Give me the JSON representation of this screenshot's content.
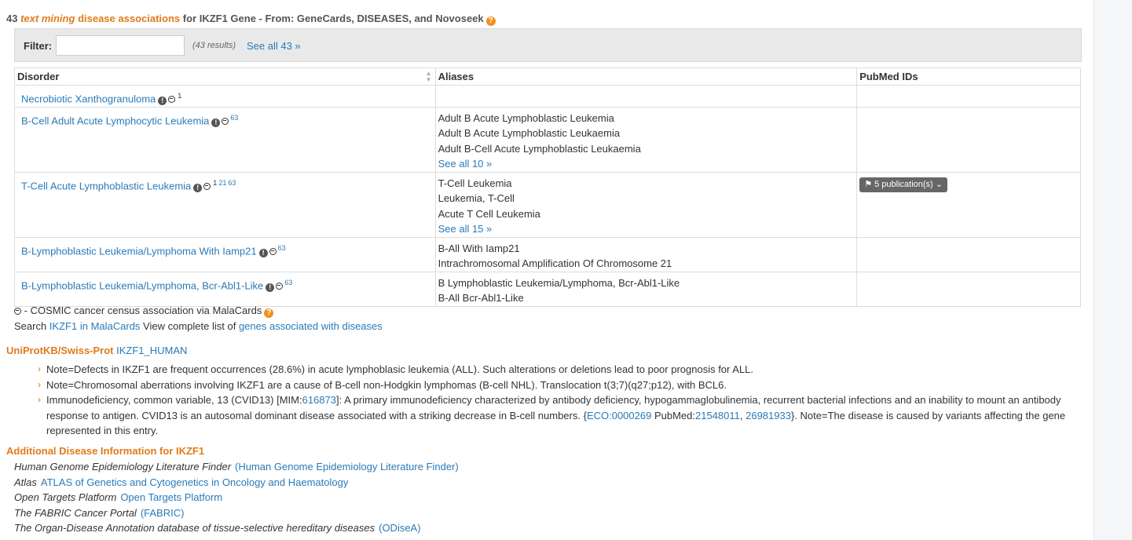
{
  "header": {
    "count": "43",
    "text_mining": "text mining",
    "disease_assoc": "disease associations",
    "rest": "for IKZF1 Gene - From: GeneCards, DISEASES, and Novoseek"
  },
  "filter": {
    "label": "Filter:",
    "value": "",
    "results": "(43 results)",
    "see_all": "See all 43 »"
  },
  "table": {
    "headers": [
      "Disorder",
      "Aliases",
      "PubMed IDs"
    ],
    "rows": [
      {
        "disorder": "Necrobiotic Xanthogranuloma",
        "sup": [
          "1"
        ],
        "aliases": [],
        "aliases_more": "",
        "pubmed": ""
      },
      {
        "disorder": "B-Cell Adult Acute Lymphocytic Leukemia",
        "sup": [
          "63"
        ],
        "aliases": [
          "Adult B Acute Lymphoblastic Leukemia",
          "Adult B Acute Lymphoblastic Leukaemia",
          "Adult B-Cell Acute Lymphoblastic Leukaemia"
        ],
        "aliases_more": "See all 10 »",
        "pubmed": ""
      },
      {
        "disorder": "T-Cell Acute Lymphoblastic Leukemia",
        "sup": [
          "1",
          "21",
          "63"
        ],
        "aliases": [
          "T-Cell Leukemia",
          "Leukemia, T-Cell",
          "Acute T Cell Leukemia"
        ],
        "aliases_more": "See all 15 »",
        "pubmed": "5 publication(s)"
      },
      {
        "disorder": "B-Lymphoblastic Leukemia/Lymphoma With Iamp21",
        "sup": [
          "63"
        ],
        "aliases": [
          "B-All With Iamp21",
          "Intrachromosomal Amplification Of Chromosome 21"
        ],
        "aliases_more": "",
        "pubmed": ""
      },
      {
        "disorder": "B-Lymphoblastic Leukemia/Lymphoma, Bcr-Abl1-Like",
        "sup": [
          "63"
        ],
        "aliases": [
          "B Lymphoblastic Leukemia/Lymphoma, Bcr-Abl1-Like",
          "B-All Bcr-Abl1-Like"
        ],
        "aliases_more": "",
        "pubmed": ""
      }
    ]
  },
  "legend": {
    "cosmic_text": "- COSMIC cancer census association via MalaCards",
    "search_prefix": "Search",
    "malacards_link": "IKZF1 in MalaCards",
    "view_text": "View complete list of",
    "genes_link": "genes associated with diseases"
  },
  "uniprot": {
    "label": "UniProtKB/Swiss-Prot",
    "link": "IKZF1_HUMAN",
    "notes": [
      {
        "text": "Note=Defects in IKZF1 are frequent occurrences (28.6%) in acute lymphoblasic leukemia (ALL). Such alterations or deletions lead to poor prognosis for ALL."
      },
      {
        "text": "Note=Chromosomal aberrations involving IKZF1 are a cause of B-cell non-Hodgkin lymphomas (B-cell NHL). Translocation t(3;7)(q27;p12), with BCL6."
      }
    ],
    "note3": {
      "p1": "Immunodeficiency, common variable, 13 (CVID13) [MIM:",
      "mim": "616873",
      "p2": "]: A primary immunodeficiency characterized by antibody deficiency, hypogammaglobulinemia, recurrent bacterial infections and an inability to mount an antibody response to antigen. CVID13 is an autosomal dominant disease associated with a striking decrease in B-cell numbers. {",
      "eco": "ECO:0000269",
      "p3": " PubMed:",
      "pm1": "21548011",
      "sep": ", ",
      "pm2": "26981933",
      "p4": "}. Note=The disease is caused by variants affecting the gene represented in this entry."
    }
  },
  "additional": {
    "title": "Additional Disease Information for IKZF1",
    "resources": [
      {
        "source": "Human Genome Epidemiology Literature Finder",
        "link": "(Human Genome Epidemiology Literature Finder)"
      },
      {
        "source": "Atlas",
        "link": "ATLAS of Genetics and Cytogenetics in Oncology and Haematology"
      },
      {
        "source": "Open Targets Platform",
        "link": "Open Targets Platform"
      },
      {
        "source": "The FABRIC Cancer Portal",
        "link": "(FABRIC)"
      },
      {
        "source": "The Organ-Disease Annotation database of tissue-selective hereditary diseases",
        "link": "(ODiseA)"
      }
    ]
  }
}
